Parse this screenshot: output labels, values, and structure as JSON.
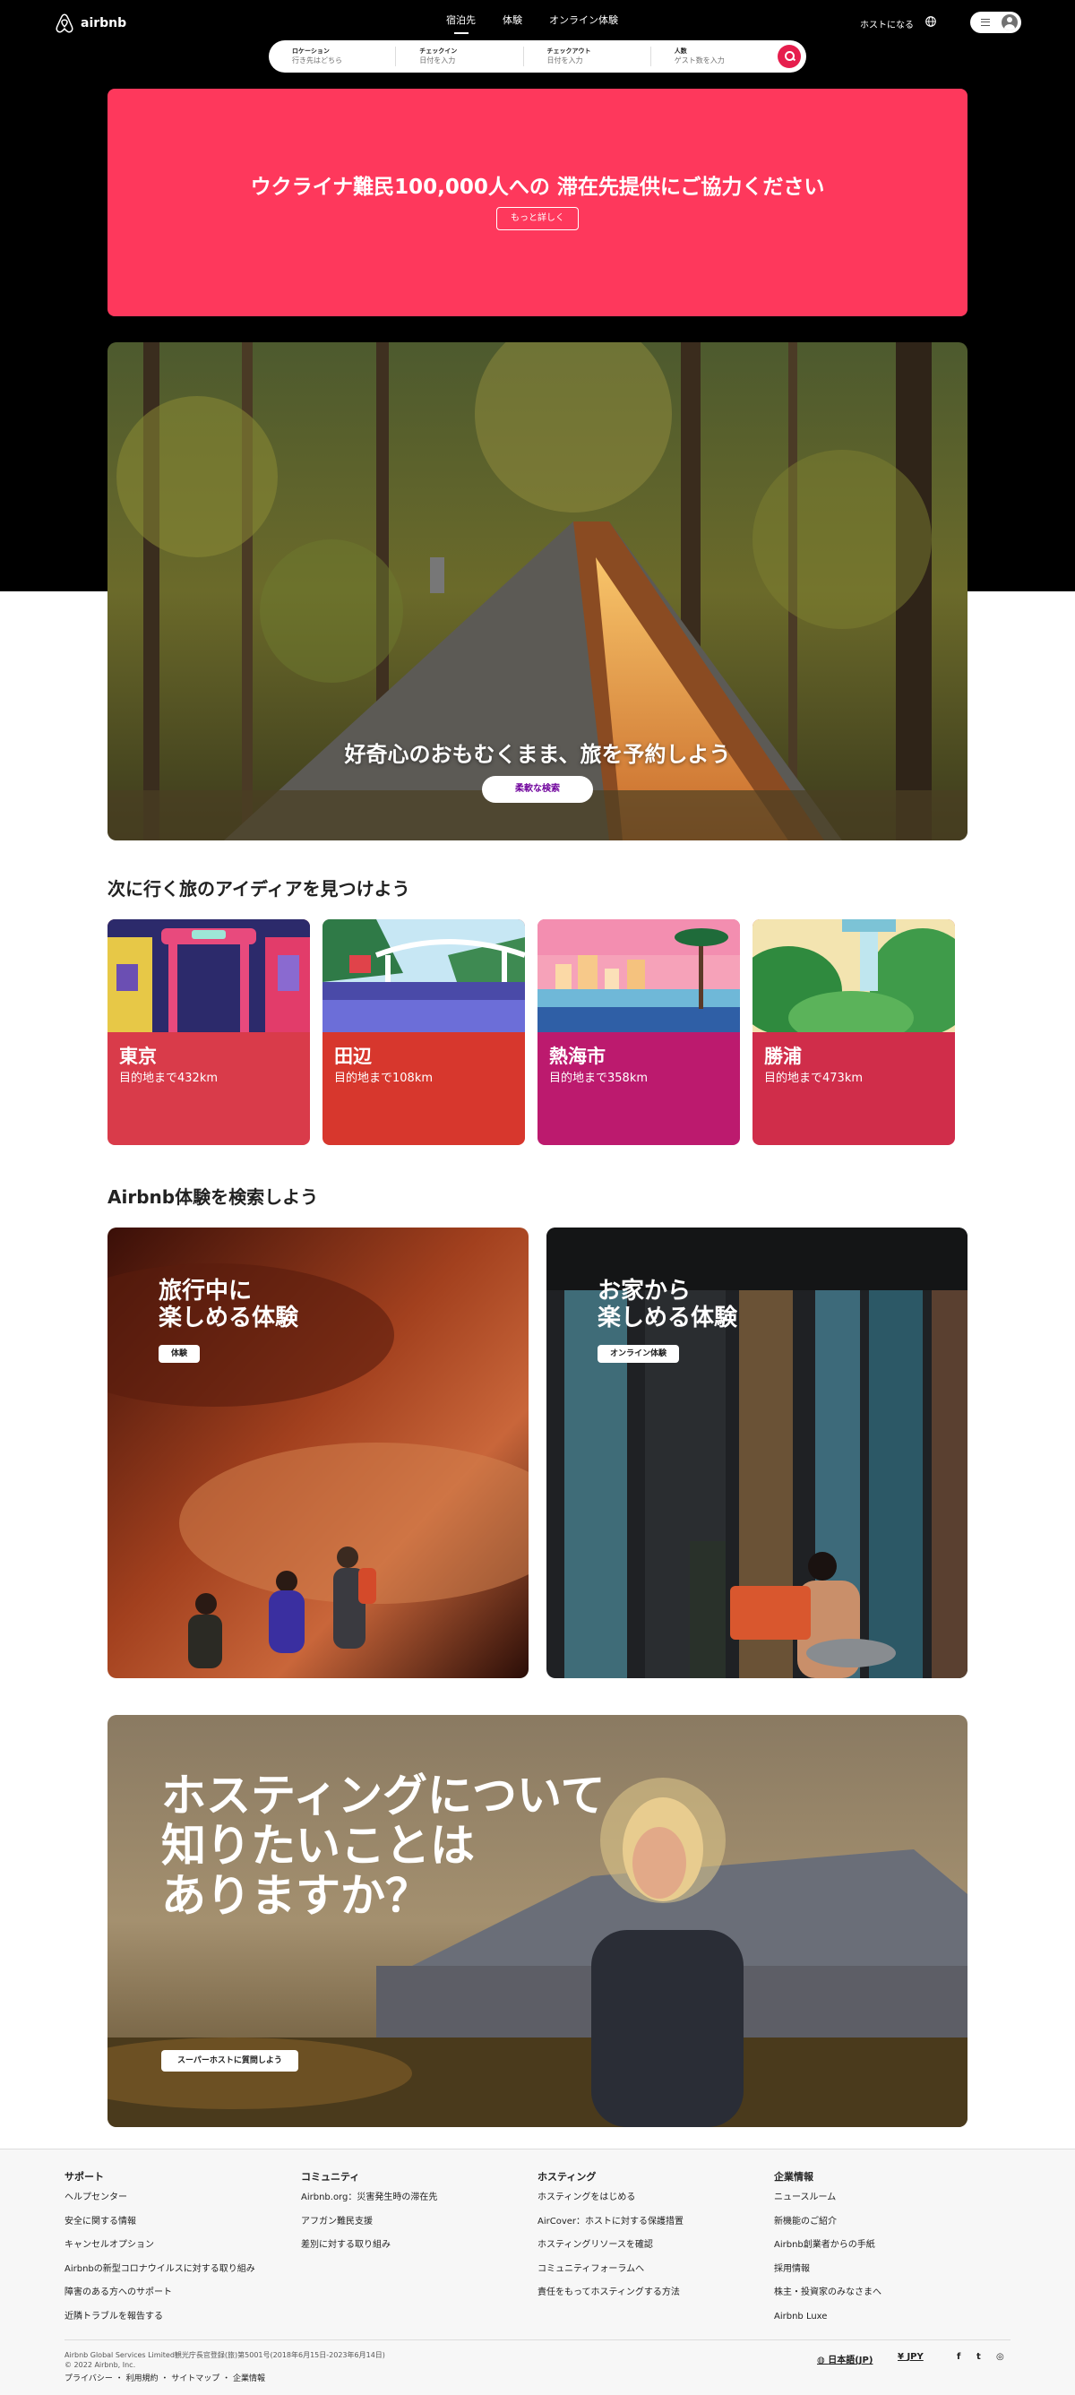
{
  "header": {
    "logo_text": "airbnb",
    "tabs": [
      {
        "label": "宿泊先",
        "active": true
      },
      {
        "label": "体験",
        "active": false
      },
      {
        "label": "オンライン体験",
        "active": false
      }
    ],
    "host_link": "ホストになる"
  },
  "search": {
    "location_label": "ロケーション",
    "location_placeholder": "行き先はどちら",
    "checkin_label": "チェックイン",
    "checkin_placeholder": "日付を入力",
    "checkout_label": "チェックアウト",
    "checkout_placeholder": "日付を入力",
    "guests_label": "人数",
    "guests_placeholder": "ゲスト数を入力"
  },
  "banner": {
    "title": "ウクライナ難民100,000人への 滞在先提供にご協力ください",
    "button": "もっと詳しく",
    "color": "#fe385c"
  },
  "hero": {
    "title": "好奇心のおもむくまま、旅を予約しよう",
    "button": "柔軟な検索"
  },
  "ideas": {
    "title": "次に行く旅のアイディアを見つけよう",
    "items": [
      {
        "name": "東京",
        "distance": "目的地まで432km",
        "color": "#d93b4a"
      },
      {
        "name": "田辺",
        "distance": "目的地まで108km",
        "color": "#d7372d"
      },
      {
        "name": "熱海市",
        "distance": "目的地まで358km",
        "color": "#bc1a6e"
      },
      {
        "name": "勝浦",
        "distance": "目的地まで473km",
        "color": "#d02d4a"
      }
    ]
  },
  "experiences": {
    "title": "Airbnb体験を検索しよう",
    "cards": [
      {
        "title_line1": "旅行中に",
        "title_line2": "楽しめる体験",
        "tag": "体験"
      },
      {
        "title_line1": "お家から",
        "title_line2": "楽しめる体験",
        "tag": "オンライン体験"
      }
    ]
  },
  "hosting": {
    "title_line1": "ホスティングについて",
    "title_line2": "知りたいことは",
    "title_line3": "ありますか？",
    "button": "スーパーホストに質問しよう"
  },
  "footer": {
    "columns": [
      {
        "heading": "サポート",
        "items": [
          "ヘルプセンター",
          "安全に関する情報",
          "キャンセルオプション",
          "Airbnbの新型コロナウイルスに対する取り組み",
          "障害のある方へのサポート",
          "近隣トラブルを報告する"
        ]
      },
      {
        "heading": "コミュニティ",
        "items": [
          "Airbnb.org：災害発生時の滞在先",
          "アフガン難民支援",
          "差別に対する取り組み"
        ]
      },
      {
        "heading": "ホスティング",
        "items": [
          "ホスティングをはじめる",
          "AirCover：ホストに対する保護措置",
          "ホスティングリソースを確認",
          "コミュニティフォーラムへ",
          "責任をもってホスティングする方法"
        ]
      },
      {
        "heading": "企業情報",
        "items": [
          "ニュースルーム",
          "新機能のご紹介",
          "Airbnb創業者からの手紙",
          "採用情報",
          "株主・投資家のみなさまへ",
          "Airbnb Luxe"
        ]
      }
    ],
    "legal_line1": "Airbnb Global Services Limited観光庁長官登録(旅)第5001号(2018年6月15日-2023年6月14日)",
    "legal_line2": "© 2022 Airbnb, Inc.",
    "links": "プライバシー ・ 利用規約 ・ サイトマップ ・ 企業情報",
    "language": "日本語(JP)",
    "currency": "JPY",
    "currency_symbol": "¥",
    "social": [
      "f",
      "t",
      "◎"
    ]
  }
}
